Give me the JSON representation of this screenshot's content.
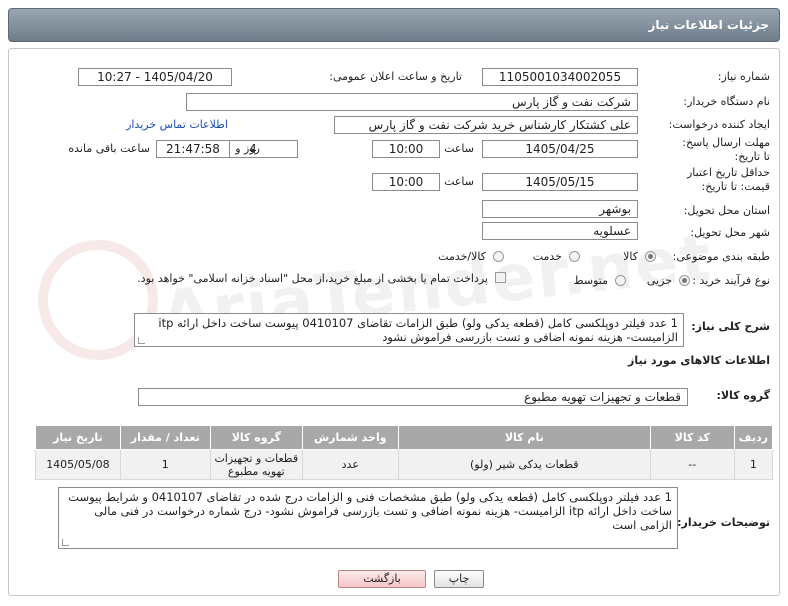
{
  "header": {
    "title": "جزئیات اطلاعات نیاز"
  },
  "fields": {
    "need_number_label": "شماره نیاز:",
    "need_number": "1105001034002055",
    "announce_label": "تاریخ و ساعت اعلان عمومی:",
    "announce_value": "1405/04/20 - 10:27",
    "buyer_org_label": "نام دستگاه خریدار:",
    "buyer_org": "شرکت نفت و گاز پارس",
    "requester_label": "ایجاد کننده درخواست:",
    "requester": "علی کشتکار کارشناس خرید شرکت نفت و گاز پارس",
    "buyer_contact_link": "اطلاعات تماس خریدار",
    "reply_deadline_label": "مهلت ارسال پاسخ: تا تاریخ:",
    "reply_date": "1405/04/25",
    "hour_label": "ساعت",
    "reply_time": "10:00",
    "days_value": "4",
    "days_and_label": "روز و",
    "remaining_time": "21:47:58",
    "remaining_label": "ساعت باقی مانده",
    "price_validity_label": "حداقل تاریخ اعتبار قیمت: تا تاریخ:",
    "validity_date": "1405/05/15",
    "validity_time": "10:00",
    "province_label": "استان محل تحویل:",
    "province": "بوشهر",
    "city_label": "شهر محل تحویل:",
    "city": "عسلویه",
    "category_label": "طبقه بندی موضوعی:",
    "category_options": [
      "کالا",
      "خدمت",
      "کالا/خدمت"
    ],
    "process_label": "نوع فرآیند خرید :",
    "process_options": [
      "جزیی",
      "متوسط"
    ],
    "payment_note": "پرداخت تمام یا بخشی از مبلغ خرید،از محل \"اسناد خزانه اسلامی\" خواهد بود."
  },
  "summary": {
    "label": "شرح کلی نیاز:",
    "text": "1 عدد فیلتر دوپلکسی کامل (قطعه یدکی ولو) طبق الزامات تقاضای 0410107 پیوست ساخت داخل ارائه itp الزامیست- هزینه نمونه اضافی و تست بازرسی فراموش نشود"
  },
  "goods_section": {
    "title": "اطلاعات کالاهای مورد نیاز",
    "group_label": "گروه کالا:",
    "group_value": "قطعات و تجهیزات تهویه مطبوع"
  },
  "table": {
    "headers": [
      "ردیف",
      "کد کالا",
      "نام کالا",
      "واحد شمارش",
      "گروه کالا",
      "تعداد / مقدار",
      "تاریخ نیاز"
    ],
    "rows": [
      [
        "1",
        "--",
        "قطعات یدکی شیر (ولو)",
        "عدد",
        "قطعات و تجهیزات تهویه مطبوع",
        "1",
        "1405/05/08"
      ]
    ]
  },
  "buyer_notes": {
    "label": "توضیحات خریدار:",
    "text": "1 عدد فیلتر دوپلکسی کامل (قطعه یدکی ولو) طبق مشخصات فنی و الزامات درج شده در تقاضای 0410107 و شرایط پیوست ساخت داخل ارائه itp الزامیست- هزینه نمونه اضافی و تست بازرسی فراموش نشود- درج شماره درخواست در فنی مالی الزامی است"
  },
  "buttons": {
    "print": "چاپ",
    "back": "بازگشت"
  },
  "colors": {
    "header_bg": "#7f8c98",
    "table_header": "#a8a8a8",
    "link": "#1a4fb5"
  }
}
